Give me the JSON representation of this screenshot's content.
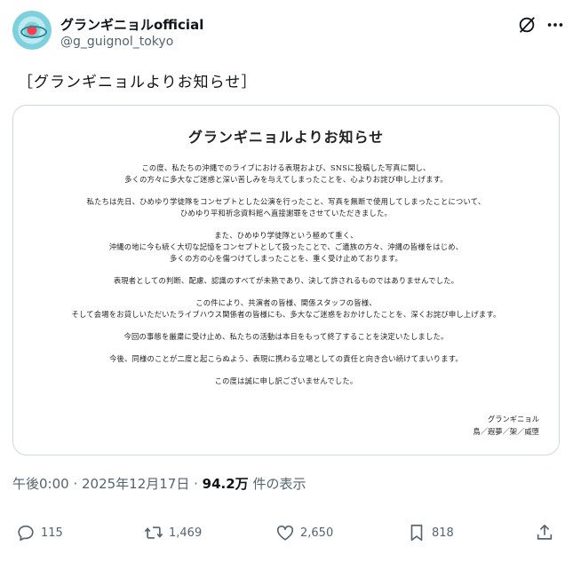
{
  "account": {
    "display_name": "グランギニョルofficial",
    "handle": "@g_guignol_tokyo"
  },
  "tweet": {
    "text": "［グランギニョルよりお知らせ］"
  },
  "notice": {
    "title": "グランギニョルよりお知らせ",
    "paragraphs": [
      "この度、私たちの沖縄でのライブにおける表現および、SNSに投稿した写真に関し、\n多くの方々に多大なご迷惑と深い苦しみを与えてしまったことを、心よりお詫び申し上げます。",
      "私たちは先日、ひめゆり学徒隊をコンセプトとした公演を行ったこと、写真を無断で使用してしまったことについて、\nひめゆり平和祈念資料館へ直接謝罪をさせていただきました。",
      "また、ひめゆり学徒隊という極めて重く、\n沖縄の地に今も続く大切な記憶をコンセプトとして扱ったことで、ご遺族の方々、沖縄の皆様をはじめ、\n多くの方の心を傷つけてしまったことを、重く受け止めております。",
      "表現者としての判断、配慮、認識のすべてが未熟であり、決して許されるものではありませんでした。",
      "この件により、共演者の皆様、関係スタッフの皆様、\nそして会場をお貸しいただいたライブハウス関係者の皆様にも、多大なご迷惑をおかけしたことを、深くお詫び申し上げます。",
      "今回の事態を厳粛に受け止め、私たちの活動は本日をもって終了することを決定いたしました。",
      "今後、同様のことが二度と起こらぬよう、表現に携わる立場としての責任と向き合い続けてまいります。",
      "この度は誠に申し訳ございませんでした。"
    ],
    "signature_name": "グランギニョル",
    "signature_members": "鳥／遐夢／架／威堕"
  },
  "meta": {
    "time": "午後0:00 · 2025年12月17日 · ",
    "views_count": "94.2万",
    "views_label": " 件の表示"
  },
  "actions": {
    "replies": "115",
    "reposts": "1,469",
    "likes": "2,650",
    "bookmarks": "818"
  }
}
